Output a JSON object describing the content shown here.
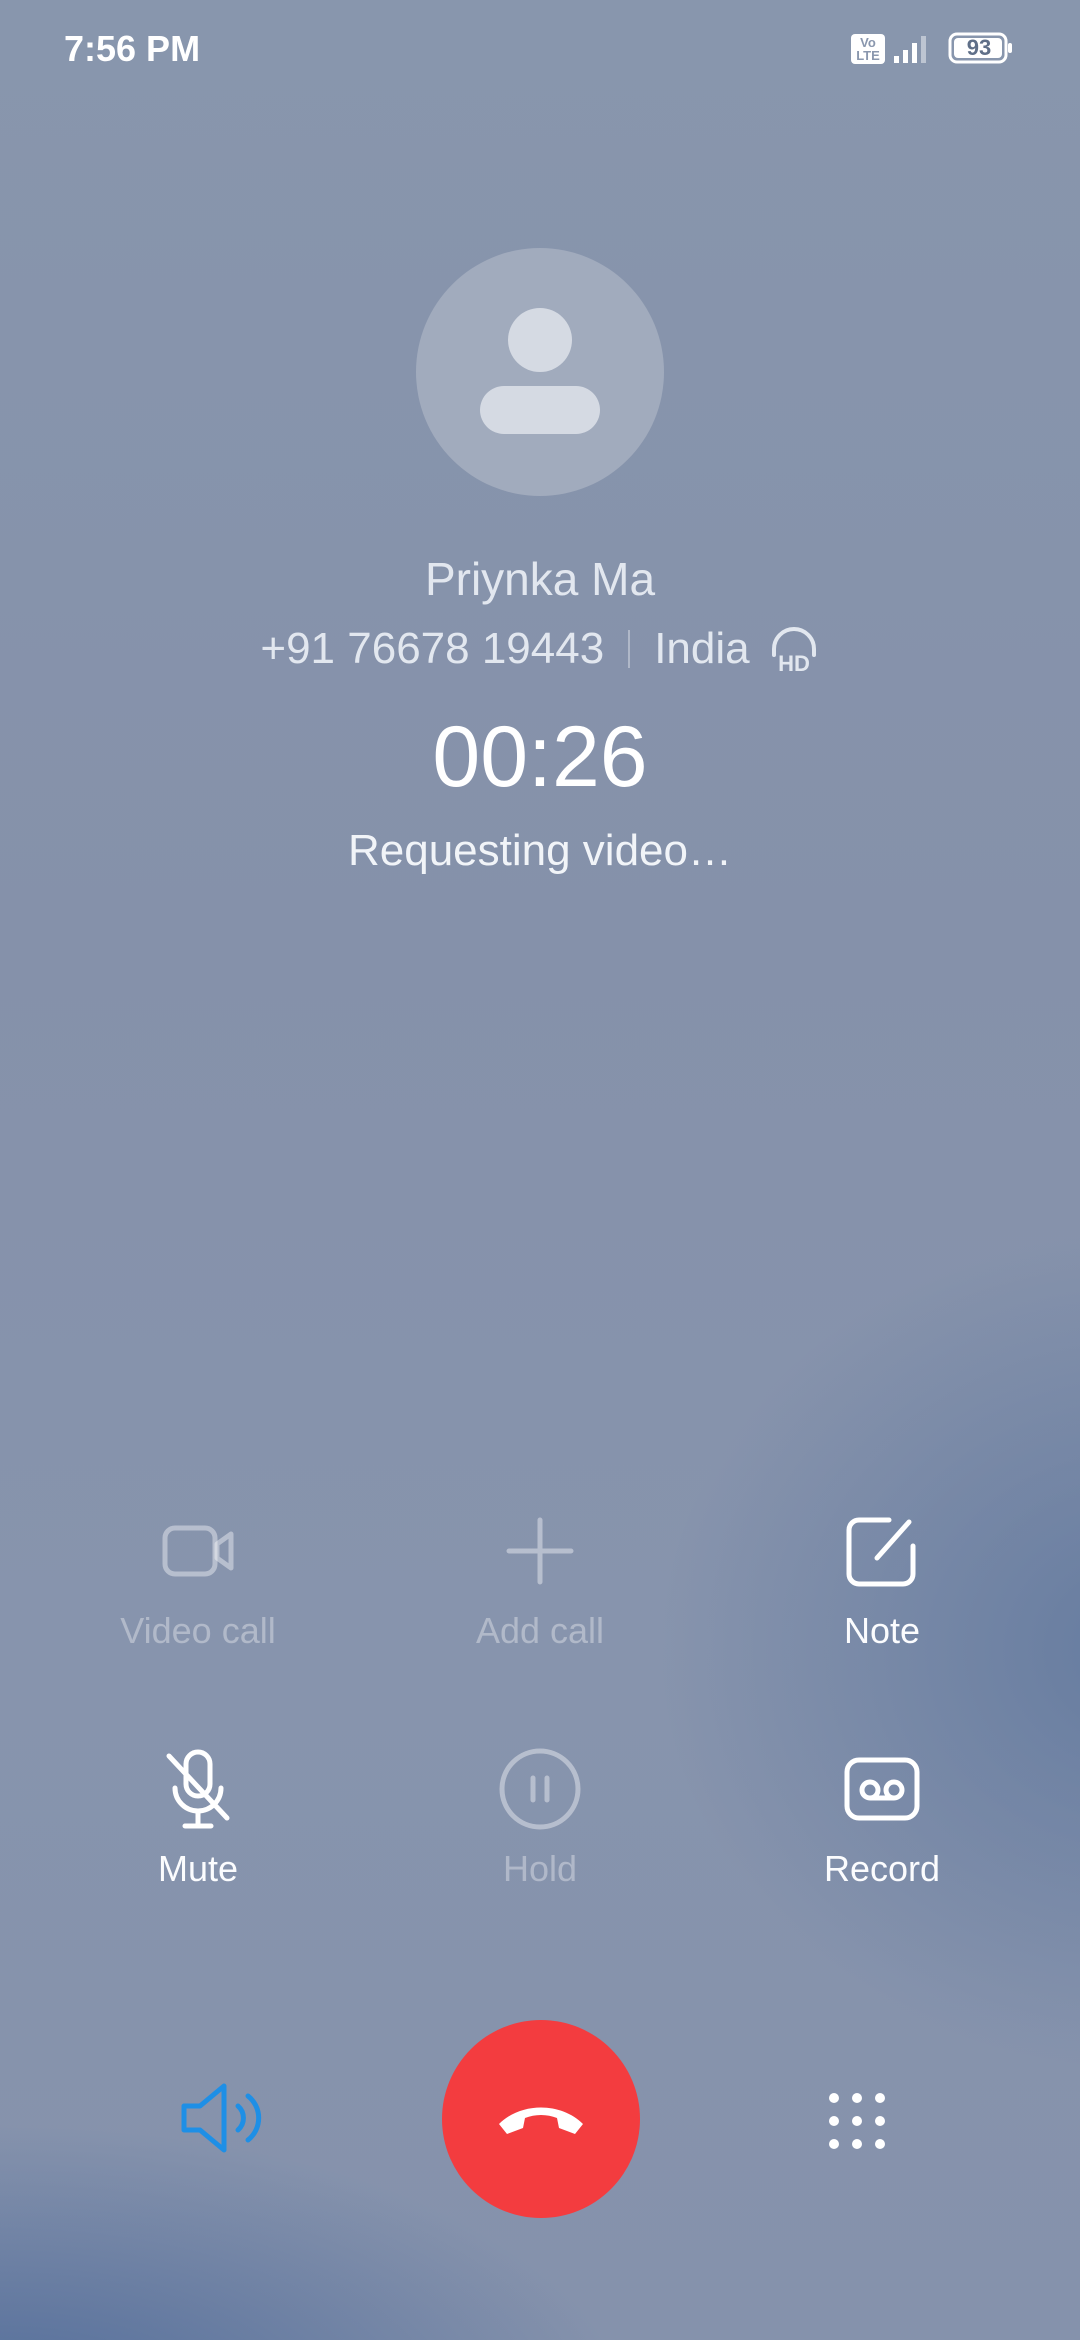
{
  "status_bar": {
    "time": "7:56 PM",
    "volte_label": "Vo LTE",
    "signal_icon": "signal-icon",
    "battery_level": "93"
  },
  "contact": {
    "name": "Priynka Ma",
    "number": "+91 76678 19443",
    "region": "India",
    "hd_icon": "hd-voice-icon"
  },
  "call": {
    "timer": "00:26",
    "status": "Requesting video…"
  },
  "controls": {
    "video_call": {
      "label": "Video call",
      "icon": "video-camera-icon",
      "enabled": false
    },
    "add_call": {
      "label": "Add call",
      "icon": "plus-icon",
      "enabled": false
    },
    "note": {
      "label": "Note",
      "icon": "note-edit-icon",
      "enabled": true
    },
    "mute": {
      "label": "Mute",
      "icon": "microphone-off-icon",
      "enabled": true
    },
    "hold": {
      "label": "Hold",
      "icon": "pause-icon",
      "enabled": false
    },
    "record": {
      "label": "Record",
      "icon": "record-tape-icon",
      "enabled": true
    }
  },
  "bottom_bar": {
    "speaker_icon": "speaker-icon",
    "speaker_color": "#1e8fe6",
    "end_call_icon": "phone-hangup-icon",
    "end_call_color": "#f33c3f",
    "keypad_icon": "dialpad-icon"
  }
}
